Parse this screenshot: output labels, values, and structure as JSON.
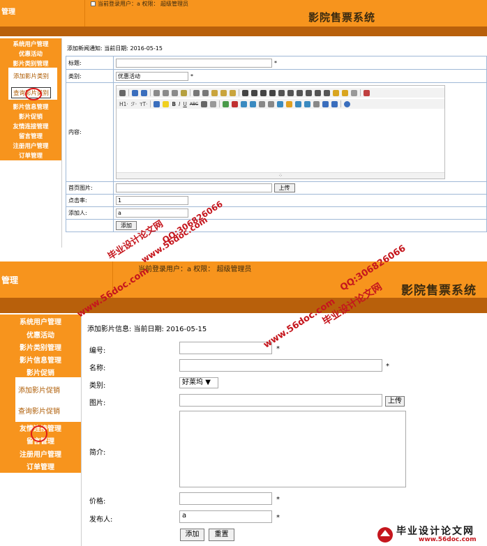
{
  "screen1": {
    "header": {
      "left_title": "管理",
      "user_info": "当前登录用户：a 权限： 超级管理员",
      "system_title": "影院售票系统"
    },
    "sidebar": {
      "items": [
        "系统用户管理",
        "优惠活动",
        "影片类别管理",
        "影片信息管理",
        "影片促销",
        "友情连接管理",
        "留言管理",
        "注册用户管理",
        "订单管理"
      ],
      "sub_items": [
        "添加影片类别",
        "查询影片类别"
      ]
    },
    "form_title": "添加新闻通知:  当前日期:  2016-05-15",
    "fields": {
      "title_label": "标题:",
      "category_label": "类别:",
      "category_value": "优惠活动",
      "content_label": "内容:",
      "image_label": "首页图片:",
      "clicks_label": "点击率:",
      "clicks_value": "1",
      "author_label": "添加人:",
      "author_value": "a",
      "upload_button": "上传",
      "add_button": "添加",
      "required": "*"
    },
    "editor_toolbar": {
      "heading": "H1·",
      "font": "ℱ·",
      "size": "тT·",
      "bold": "B",
      "italic": "I",
      "underline": "U",
      "strike": "ABC"
    }
  },
  "screen2": {
    "header": {
      "left_title": "管理",
      "user_info": "当前登录用户：a 权限：  超级管理员",
      "system_title": "影院售票系统"
    },
    "sidebar": {
      "items": [
        "系统用户管理",
        "优惠活动",
        "影片类别管理",
        "影片信息管理",
        "影片促销",
        "友情连接管理",
        "留言管理",
        "注册用户管理",
        "订单管理"
      ],
      "sub_items": [
        "添加影片促销",
        "查询影片促销"
      ]
    },
    "form_title": "添加影片信息:  当前日期:  2016-05-15",
    "fields": {
      "number_label": "编号:",
      "name_label": "名称:",
      "category_label": "类别:",
      "category_value": "好莱坞",
      "image_label": "图片:",
      "intro_label": "简介:",
      "price_label": "价格:",
      "publisher_label": "发布人:",
      "publisher_value": "a",
      "upload_button": "上传",
      "add_button": "添加",
      "reset_button": "重置",
      "required": "*"
    }
  },
  "watermarks": {
    "site": "www.56doc.com",
    "qq": "QQ:306826066",
    "brand": "毕业设计论文网",
    "corner_brand": "毕业设计论文网",
    "corner_site": "www.56doc.com"
  }
}
